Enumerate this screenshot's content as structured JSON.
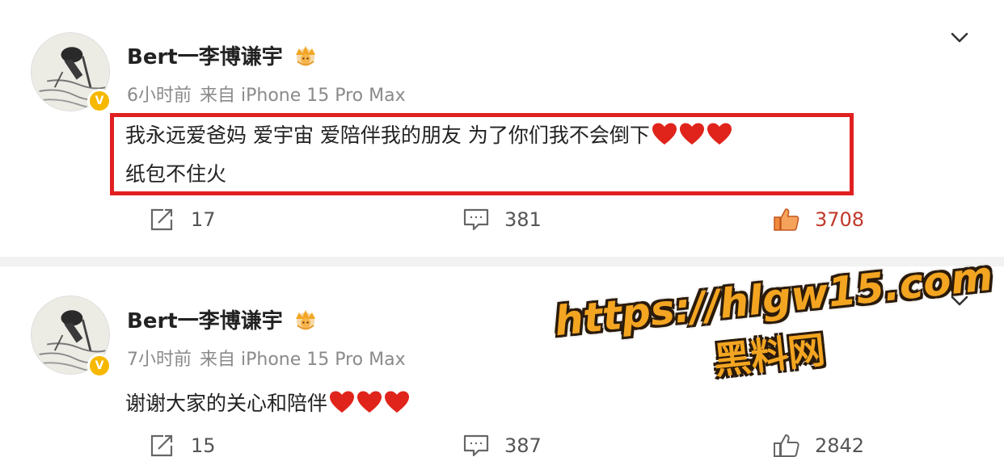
{
  "colors": {
    "highlight_border": "#e02020",
    "like_active": "#c0392b",
    "watermark": "#f3a521",
    "verified_badge": "#f6b800"
  },
  "posts": [
    {
      "username": "Bert一李博谦宇",
      "time": "6小时前",
      "source": "来自 iPhone 15 Pro Max",
      "content_lines": [
        "我永远爱爸妈 爱宇宙 爱陪伴我的朋友 为了你们我不会倒下",
        "纸包不住火"
      ],
      "reposts": "17",
      "comments": "381",
      "likes": "3708",
      "highlighted": true,
      "liked": true
    },
    {
      "username": "Bert一李博谦宇",
      "time": "7小时前",
      "source": "来自 iPhone 15 Pro Max",
      "content_lines": [
        "谢谢大家的关心和陪伴"
      ],
      "reposts": "15",
      "comments": "387",
      "likes": "2842",
      "highlighted": false,
      "liked": false
    }
  ],
  "watermark": {
    "line1": "https://hlgw15.com",
    "line2": "黑料网"
  },
  "icons": {
    "verified": "V",
    "member_crown": "crown-icon",
    "more": "chevron-down-icon",
    "repost": "repost-icon",
    "comment": "comment-icon",
    "like": "thumbs-up-icon",
    "heart": "red-heart-emoji"
  }
}
